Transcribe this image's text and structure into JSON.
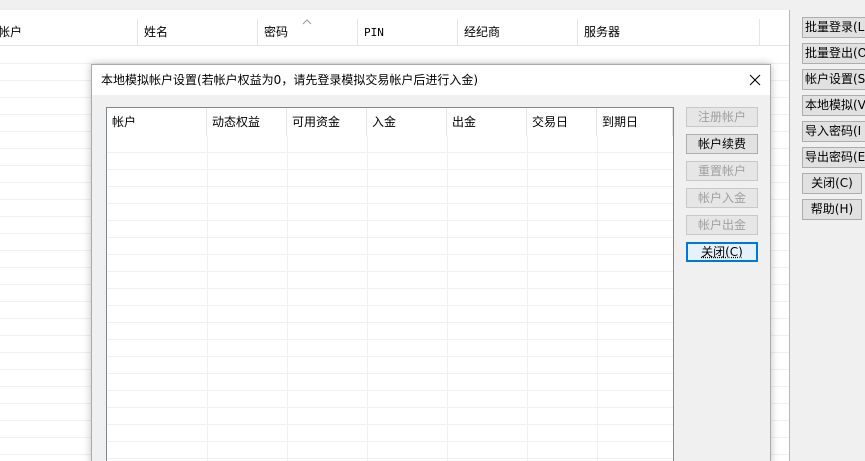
{
  "background": {
    "columns": [
      {
        "label": "帐户",
        "mono": false
      },
      {
        "label": "姓名",
        "mono": false
      },
      {
        "label": "密码",
        "mono": false
      },
      {
        "label": "PIN",
        "mono": true
      },
      {
        "label": "经纪商",
        "mono": false
      },
      {
        "label": "服务器",
        "mono": false
      }
    ],
    "sort_column": "密码",
    "side_buttons": [
      {
        "label": "批量登录(L",
        "center": false
      },
      {
        "label": "批量登出(O",
        "center": false
      },
      {
        "label": "帐户设置(S",
        "center": false
      },
      {
        "label": "本地模拟(V",
        "center": false
      },
      {
        "label": "导入密码(I",
        "center": false
      },
      {
        "label": "导出密码(E",
        "center": false
      },
      {
        "label": "关闭(C)",
        "center": true
      },
      {
        "label": "帮助(H)",
        "center": true
      }
    ]
  },
  "dialog": {
    "title": "本地模拟帐户设置(若帐户权益为0，请先登录模拟交易帐户后进行入金)",
    "columns": [
      "帐户",
      "动态权益",
      "可用资金",
      "入金",
      "出金",
      "交易日",
      "到期日"
    ],
    "rows": [],
    "buttons": [
      {
        "label": "注册帐户",
        "enabled": false,
        "focused": false
      },
      {
        "label": "帐户续费",
        "enabled": true,
        "focused": false
      },
      {
        "label": "重置帐户",
        "enabled": false,
        "focused": false
      },
      {
        "label": "帐户入金",
        "enabled": false,
        "focused": false
      },
      {
        "label": "帐户出金",
        "enabled": false,
        "focused": false
      },
      {
        "label": "关闭(C)",
        "enabled": true,
        "focused": true
      }
    ]
  },
  "icons": {
    "close": "close-icon",
    "sort": "sort-ascending-icon"
  }
}
